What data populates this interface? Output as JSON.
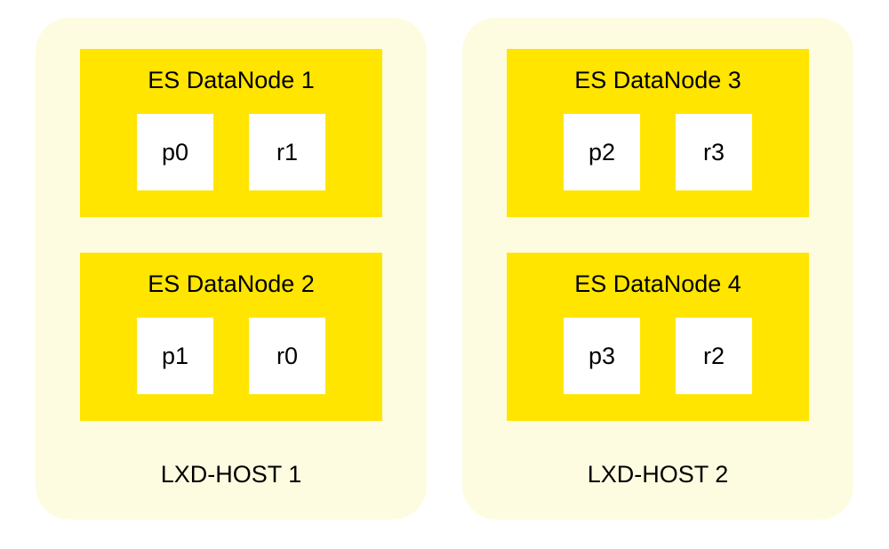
{
  "hosts": [
    {
      "label": "LXD-HOST 1",
      "datanodes": [
        {
          "title": "ES DataNode 1",
          "shards": [
            "p0",
            "r1"
          ]
        },
        {
          "title": "ES DataNode 2",
          "shards": [
            "p1",
            "r0"
          ]
        }
      ]
    },
    {
      "label": "LXD-HOST 2",
      "datanodes": [
        {
          "title": "ES DataNode 3",
          "shards": [
            "p2",
            "r3"
          ]
        },
        {
          "title": "ES DataNode 4",
          "shards": [
            "p3",
            "r2"
          ]
        }
      ]
    }
  ]
}
